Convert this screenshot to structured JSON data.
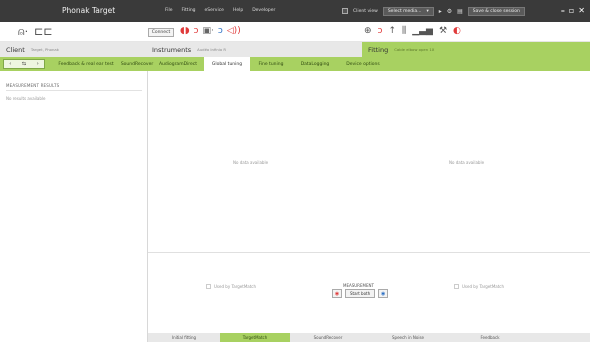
{
  "app_title": "Phonak Target",
  "menu": [
    "File",
    "Fitting",
    "eService",
    "Help",
    "Developer"
  ],
  "titlebar": {
    "client_view": "Client view",
    "select_media": "Select media...",
    "save_close": "Save & close session"
  },
  "toolbar": {
    "connect": "Connect"
  },
  "sections": {
    "client": {
      "title": "Client",
      "sub": "Target, Phonak"
    },
    "instruments": {
      "title": "Instruments",
      "sub": "Audéo Infinio R"
    },
    "fitting": {
      "title": "Fitting",
      "sub": "Cable elbow open 1X"
    }
  },
  "tabs": [
    "Feedback & real ear test",
    "SoundRecover",
    "AudiogramDirect",
    "Global tuning",
    "Fine tuning",
    "DataLogging",
    "Device options"
  ],
  "active_tab": "Global tuning",
  "left_panel": {
    "heading": "MEASUREMENT RESULTS",
    "empty": "No results available"
  },
  "main": {
    "no_data_left": "No data available",
    "no_data_right": "No data available",
    "used_left": "Used by TargetMatch",
    "used_right": "Used by TargetMatch",
    "measurement_label": "MEASUREMENT",
    "start_both": "Start both"
  },
  "bottom_tabs": [
    "Initial fitting",
    "TargetMatch",
    "SoundRecover",
    "Speech in Noise",
    "Feedback"
  ],
  "active_bottom_tab": "TargetMatch",
  "colors": {
    "accent_green": "#a8d161",
    "titlebar": "#3a3a3a",
    "red_icon": "#e03a3a",
    "blue_icon": "#2b6fc4"
  }
}
